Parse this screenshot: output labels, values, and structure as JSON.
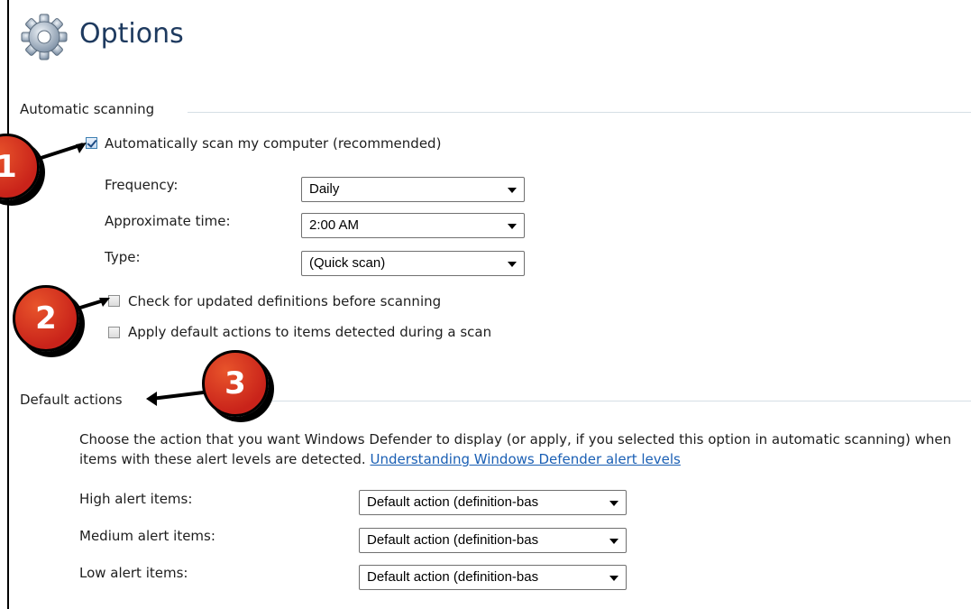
{
  "page": {
    "title": "Options"
  },
  "automatic_scanning": {
    "heading": "Automatic scanning",
    "auto_scan": {
      "label": "Automatically scan my computer (recommended)",
      "checked": true
    },
    "frequency": {
      "label": "Frequency:",
      "value": "Daily"
    },
    "time": {
      "label": "Approximate time:",
      "value": "2:00 AM"
    },
    "type": {
      "label": "Type:",
      "value": "(Quick scan)"
    },
    "check_definitions": {
      "label": "Check for updated definitions before scanning",
      "checked": false
    },
    "apply_default": {
      "label": "Apply default actions to items detected during a scan",
      "checked": false
    }
  },
  "default_actions": {
    "heading": "Default actions",
    "description": "Choose the action that you want Windows Defender to display (or apply, if you selected this option in automatic scanning) when items with these alert levels are detected.",
    "link": "Understanding Windows Defender alert levels",
    "high": {
      "label": "High alert items:",
      "value": "Default action (definition-bas"
    },
    "medium": {
      "label": "Medium alert items:",
      "value": "Default action (definition-bas"
    },
    "low": {
      "label": "Low alert items:",
      "value": "Default action (definition-bas"
    }
  },
  "callouts": [
    "1",
    "2",
    "3"
  ],
  "colors": {
    "callout": "#d1331f",
    "link": "#1a5fb4",
    "title": "#1e3a5f"
  },
  "icons": {
    "title_icon": "gear-icon",
    "dropdown": "chevron-down-icon"
  }
}
